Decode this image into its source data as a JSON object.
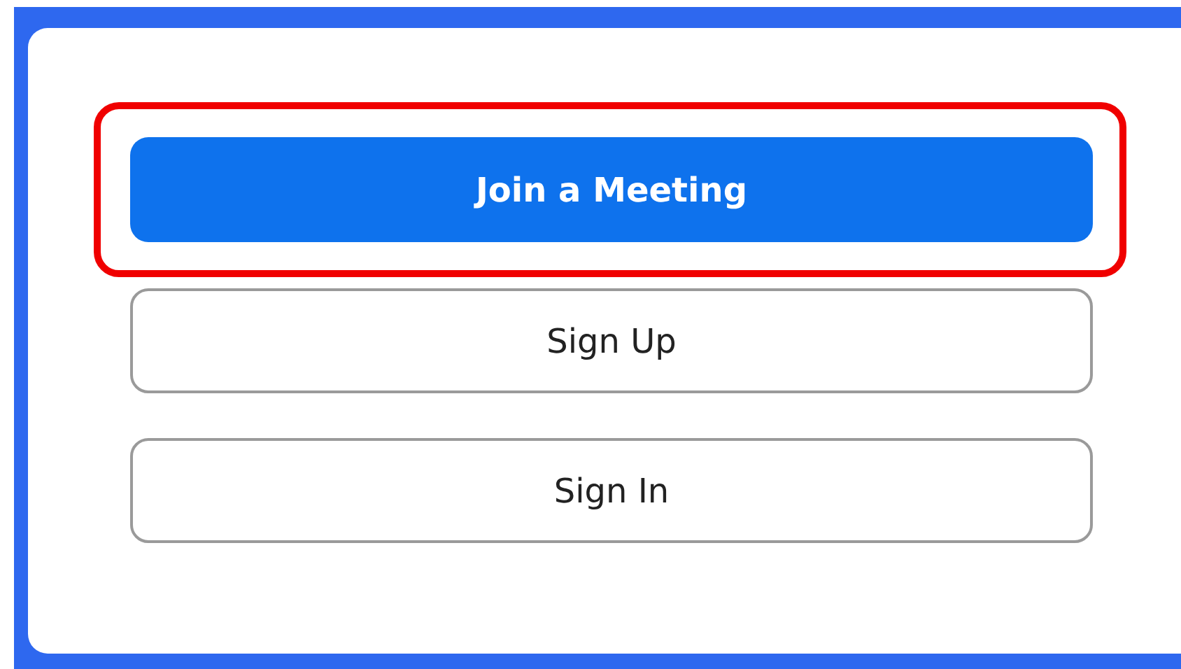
{
  "buttons": [
    {
      "label": "Join a Meeting",
      "kind": "primary",
      "highlighted": true
    },
    {
      "label": "Sign Up",
      "kind": "outline",
      "highlighted": false
    },
    {
      "label": "Sign In",
      "kind": "outline",
      "highlighted": false
    }
  ]
}
